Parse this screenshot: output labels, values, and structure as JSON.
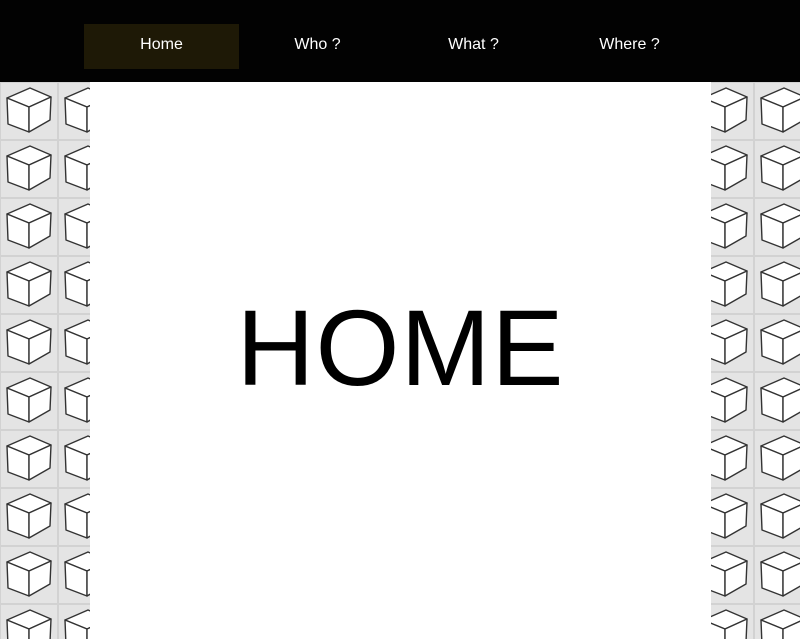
{
  "nav": {
    "items": [
      {
        "label": "Home",
        "active": true
      },
      {
        "label": "Who ?",
        "active": false
      },
      {
        "label": "What ?",
        "active": false
      },
      {
        "label": "Where ?",
        "active": false
      }
    ]
  },
  "main": {
    "title": "HOME"
  },
  "colors": {
    "topbar": "#020202",
    "active_tab": "#1e1906",
    "pattern_background": "#e4e4e4",
    "content_background": "#ffffff"
  },
  "icons": {
    "background_pattern": "cube-icon"
  }
}
